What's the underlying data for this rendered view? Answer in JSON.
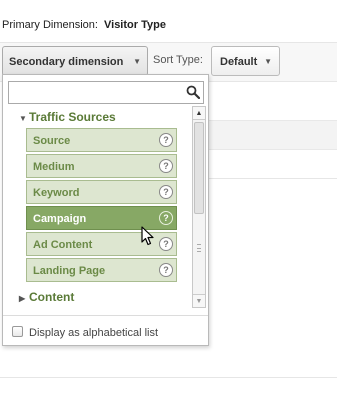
{
  "primary": {
    "label": "Primary Dimension:",
    "value": "Visitor Type"
  },
  "toolbar": {
    "secondary_label": "Secondary dimension",
    "sort_label": "Sort Type:",
    "sort_value": "Default"
  },
  "dropdown": {
    "search": {
      "value": "",
      "placeholder": ""
    },
    "groups": [
      {
        "label": "Traffic Sources",
        "expanded": true,
        "items": [
          {
            "label": "Source",
            "help": "?"
          },
          {
            "label": "Medium",
            "help": "?"
          },
          {
            "label": "Keyword",
            "help": "?"
          },
          {
            "label": "Campaign",
            "help": "?",
            "active": true
          },
          {
            "label": "Ad Content",
            "help": "?"
          },
          {
            "label": "Landing Page",
            "help": "?"
          }
        ]
      },
      {
        "label": "Content",
        "expanded": false
      }
    ],
    "footer": {
      "checkbox_label": "Display as alphabetical list",
      "checked": false
    }
  },
  "colors": {
    "group_heading": "#5a7a37",
    "item_bg": "#dde6d0",
    "item_text": "#6b8a47",
    "item_active_bg": "#87a865",
    "item_active_text": "#ffffff"
  },
  "icons": {
    "search": "search-icon",
    "help": "help-circle-icon",
    "expanded": "triangle-down-icon",
    "collapsed": "triangle-right-icon",
    "caret": "caret-down-icon",
    "cursor": "mouse-pointer-icon"
  }
}
